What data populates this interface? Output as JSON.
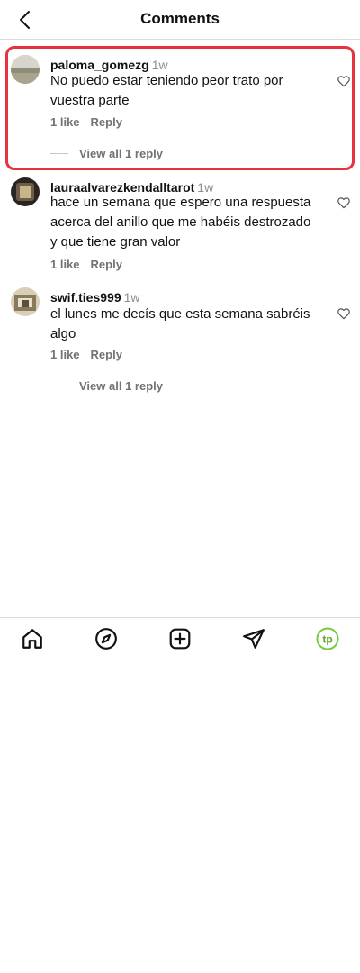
{
  "header": {
    "title": "Comments"
  },
  "comments": [
    {
      "username": "paloma_gomezg",
      "time": "1w",
      "text": "No puedo estar teniendo peor trato por vuestra parte",
      "likes": "1 like",
      "reply": "Reply",
      "view_replies": "View all 1 reply"
    },
    {
      "username": "lauraalvarezkendalltarot",
      "time": "1w",
      "text": "hace un semana que espero una respuesta acerca del anillo que me habéis destrozado y que tiene gran valor",
      "likes": "1 like",
      "reply": "Reply"
    },
    {
      "username": "swif.ties999",
      "time": "1w",
      "text": "el lunes me decís que esta semana sabréis algo",
      "likes": "1 like",
      "reply": "Reply",
      "view_replies": "View all 1 reply"
    }
  ],
  "bottom_nav": {
    "items": [
      "home-icon",
      "explore-icon",
      "create-icon",
      "direct-icon",
      "profile-icon"
    ],
    "profile_initials": "tp",
    "profile_color": "#7ac943"
  },
  "colors": {
    "highlight": "#e5343f",
    "muted": "#737373"
  }
}
